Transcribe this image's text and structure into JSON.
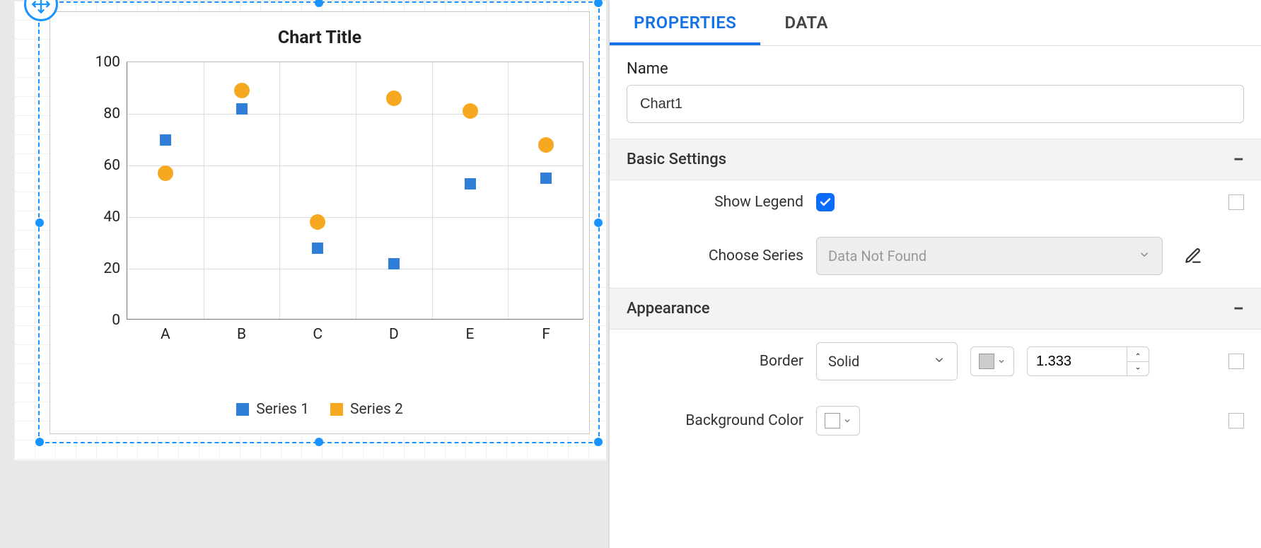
{
  "tabs": {
    "properties": "PROPERTIES",
    "data": "DATA"
  },
  "sections": {
    "name_label": "Name",
    "name_value": "Chart1",
    "basic_settings": "Basic Settings",
    "show_legend": "Show Legend",
    "show_legend_checked": true,
    "choose_series": "Choose Series",
    "choose_series_placeholder": "Data Not Found",
    "appearance": "Appearance",
    "border_label": "Border",
    "border_style": "Solid",
    "border_width": "1.333",
    "border_color": "#cccccc",
    "background_color_label": "Background Color",
    "background_color": "#ffffff"
  },
  "chart_data": {
    "type": "scatter",
    "title": "Chart Title",
    "categories": [
      "A",
      "B",
      "C",
      "D",
      "E",
      "F"
    ],
    "series": [
      {
        "name": "Series 1",
        "color": "#2f7ed8",
        "marker": "square",
        "values": [
          70,
          82,
          28,
          22,
          53,
          55
        ]
      },
      {
        "name": "Series 2",
        "color": "#f6a821",
        "marker": "circle",
        "values": [
          57,
          89,
          38,
          86,
          81,
          68
        ]
      }
    ],
    "ylim": [
      0,
      100
    ],
    "yticks": [
      0,
      20,
      40,
      60,
      80,
      100
    ],
    "xlabel": "",
    "ylabel": ""
  }
}
